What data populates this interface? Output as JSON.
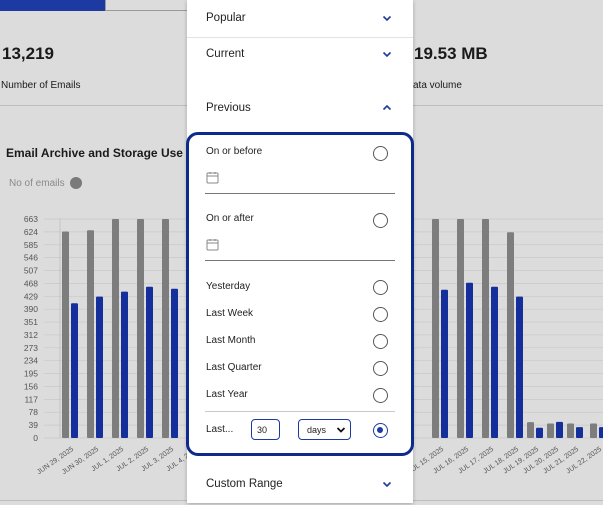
{
  "dashboard": {
    "stat_left_value": "13,219",
    "stat_left_label": "Number of Emails",
    "stat_right_value": "19.53 MB",
    "stat_right_label": "ata volume",
    "section_title": "Email Archive and Storage Use",
    "legend_label": "No of emails",
    "colors": {
      "grey_series": "#7d7d7d",
      "blue_series": "#142f9c"
    }
  },
  "chart_data": {
    "type": "bar",
    "yticks": [
      "663",
      "624",
      "585",
      "546",
      "507",
      "468",
      "429",
      "390",
      "351",
      "312",
      "273",
      "234",
      "195",
      "156",
      "117",
      "78",
      "39",
      "0"
    ],
    "ylim": [
      0,
      663
    ],
    "categories": [
      "JUN 29, 2025",
      "JUN 30, 2025",
      "JUL 1, 2025",
      "JUL 2, 2025",
      "JUL 3, 2025",
      "JUL 4, 2025",
      "JUL 15, 2025",
      "JUL 16, 2025",
      "JUL 17, 2025",
      "JUL 18, 2025",
      "JUL 19, 2025",
      "JUL 20, 2025",
      "JUL 21, 2025",
      "JUL 22, 2025"
    ],
    "series": [
      {
        "name": "No of emails",
        "values": [
          625,
          629,
          663,
          663,
          663,
          663,
          663,
          663,
          663,
          623,
          48,
          44,
          44,
          44
        ]
      },
      {
        "values": [
          408,
          428,
          443,
          458,
          452,
          null,
          449,
          470,
          458,
          428,
          31,
          49,
          33,
          33
        ]
      }
    ]
  },
  "filter_panel": {
    "popular_label": "Popular",
    "current_label": "Current",
    "previous_label": "Previous",
    "custom_range_label": "Custom Range",
    "on_or_before_label": "On or before",
    "on_or_after_label": "On or after",
    "options": [
      "Yesterday",
      "Last Week",
      "Last Month",
      "Last Quarter",
      "Last Year"
    ],
    "last_label": "Last...",
    "last_value": "30",
    "unit_selected": "days",
    "selected_option": "Last..."
  }
}
